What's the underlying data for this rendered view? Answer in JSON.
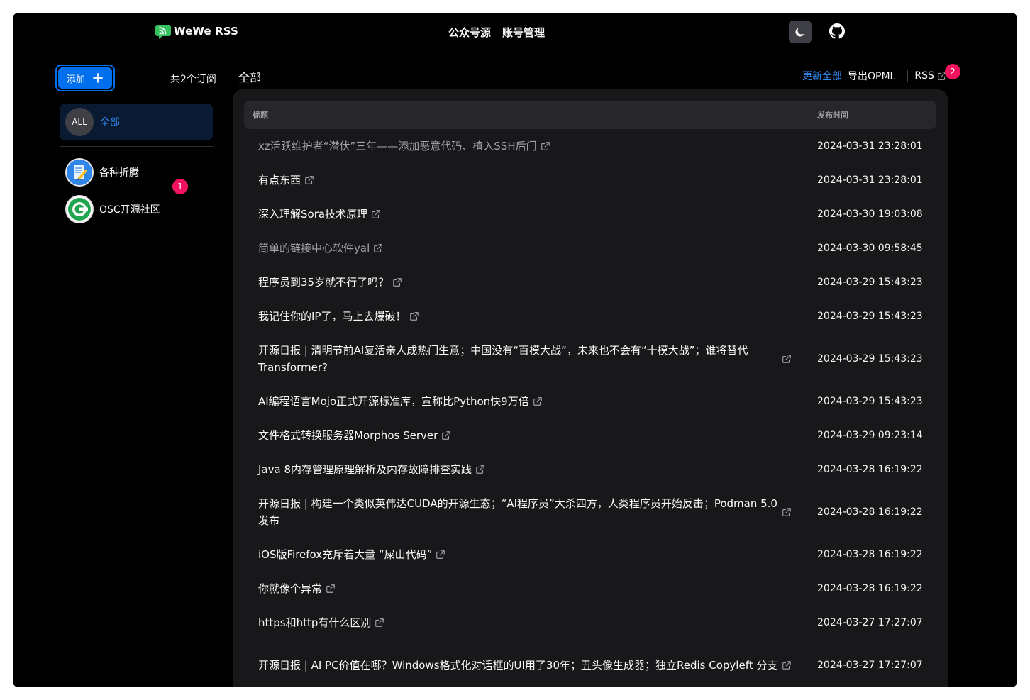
{
  "brand": {
    "name": "WeWe RSS"
  },
  "nav": {
    "feeds": "公众号源",
    "accounts": "账号管理"
  },
  "sidebar": {
    "add_label": "添加",
    "sub_count": "共2个订阅",
    "all": {
      "avatar": "ALL",
      "label": "全部"
    },
    "feeds": [
      {
        "name": "各种折腾",
        "icon": "notepad-icon"
      },
      {
        "name": "OSC开源社区",
        "icon": "osc-logo-icon"
      }
    ],
    "badge": "1"
  },
  "main": {
    "title": "全部",
    "actions": {
      "update_all": "更新全部",
      "export_opml": "导出OPML",
      "rss": "RSS",
      "badge": "2"
    },
    "table": {
      "headers": {
        "title": "标题",
        "time": "发布时间"
      },
      "rows": [
        {
          "title": "xz活跃维护者“潜伏”三年——添加恶意代码、植入SSH后门",
          "time": "2024-03-31 23:28:01",
          "read": true
        },
        {
          "title": "有点东西",
          "time": "2024-03-31 23:28:01",
          "read": false
        },
        {
          "title": "深入理解Sora技术原理",
          "time": "2024-03-30 19:03:08",
          "read": false
        },
        {
          "title": "简单的链接中心软件yal",
          "time": "2024-03-30 09:58:45",
          "read": true
        },
        {
          "title": "程序员到35岁就不行了吗？",
          "time": "2024-03-29 15:43:23",
          "read": false
        },
        {
          "title": "我记住你的IP了，马上去爆破！",
          "time": "2024-03-29 15:43:23",
          "read": false
        },
        {
          "title": "开源日报 | 清明节前AI复活亲人成热门生意；中国没有“百模大战”，未来也不会有“十模大战”；谁将替代Transformer?",
          "time": "2024-03-29 15:43:23",
          "read": false,
          "multiline": true
        },
        {
          "title": "AI编程语言Mojo正式开源标准库，宣称比Python快9万倍",
          "time": "2024-03-29 15:43:23",
          "read": false
        },
        {
          "title": "文件格式转换服务器Morphos Server",
          "time": "2024-03-29 09:23:14",
          "read": false
        },
        {
          "title": "Java 8内存管理原理解析及内存故障排查实践",
          "time": "2024-03-28 16:19:22",
          "read": false
        },
        {
          "title": "开源日报 | 构建一个类似英伟达CUDA的开源生态；“AI程序员”大杀四方，人类程序员开始反击；Podman 5.0发布",
          "time": "2024-03-28 16:19:22",
          "read": false,
          "multiline": true
        },
        {
          "title": "iOS版Firefox充斥着大量 “屎山代码”",
          "time": "2024-03-28 16:19:22",
          "read": false
        },
        {
          "title": "你就像个异常",
          "time": "2024-03-28 16:19:22",
          "read": false
        },
        {
          "title": "https和http有什么区别",
          "time": "2024-03-27 17:27:07",
          "read": false
        },
        {
          "title": "开源日报 | AI PC价值在哪？Windows格式化对话框的UI用了30年；丑头像生成器；独立Redis Copyleft 分支",
          "time": "2024-03-27 17:27:07",
          "read": false,
          "multiline": true
        }
      ]
    }
  }
}
